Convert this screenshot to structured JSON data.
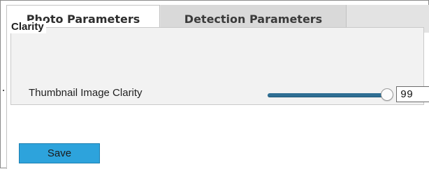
{
  "tabs": [
    {
      "label": "Photo Parameters",
      "active": true
    },
    {
      "label": "Detection Parameters",
      "active": false
    }
  ],
  "clarity_section": {
    "legend": "Clarity",
    "thumbnail_clarity": {
      "label": "Thumbnail Image Clarity",
      "value": "99",
      "slider_level_percent": 99
    }
  },
  "actions": {
    "save_label": "Save"
  },
  "colors": {
    "accent": "#2da3dc",
    "slider_track": "#2f6f94",
    "tabbar_bg": "#e3e3e3"
  }
}
